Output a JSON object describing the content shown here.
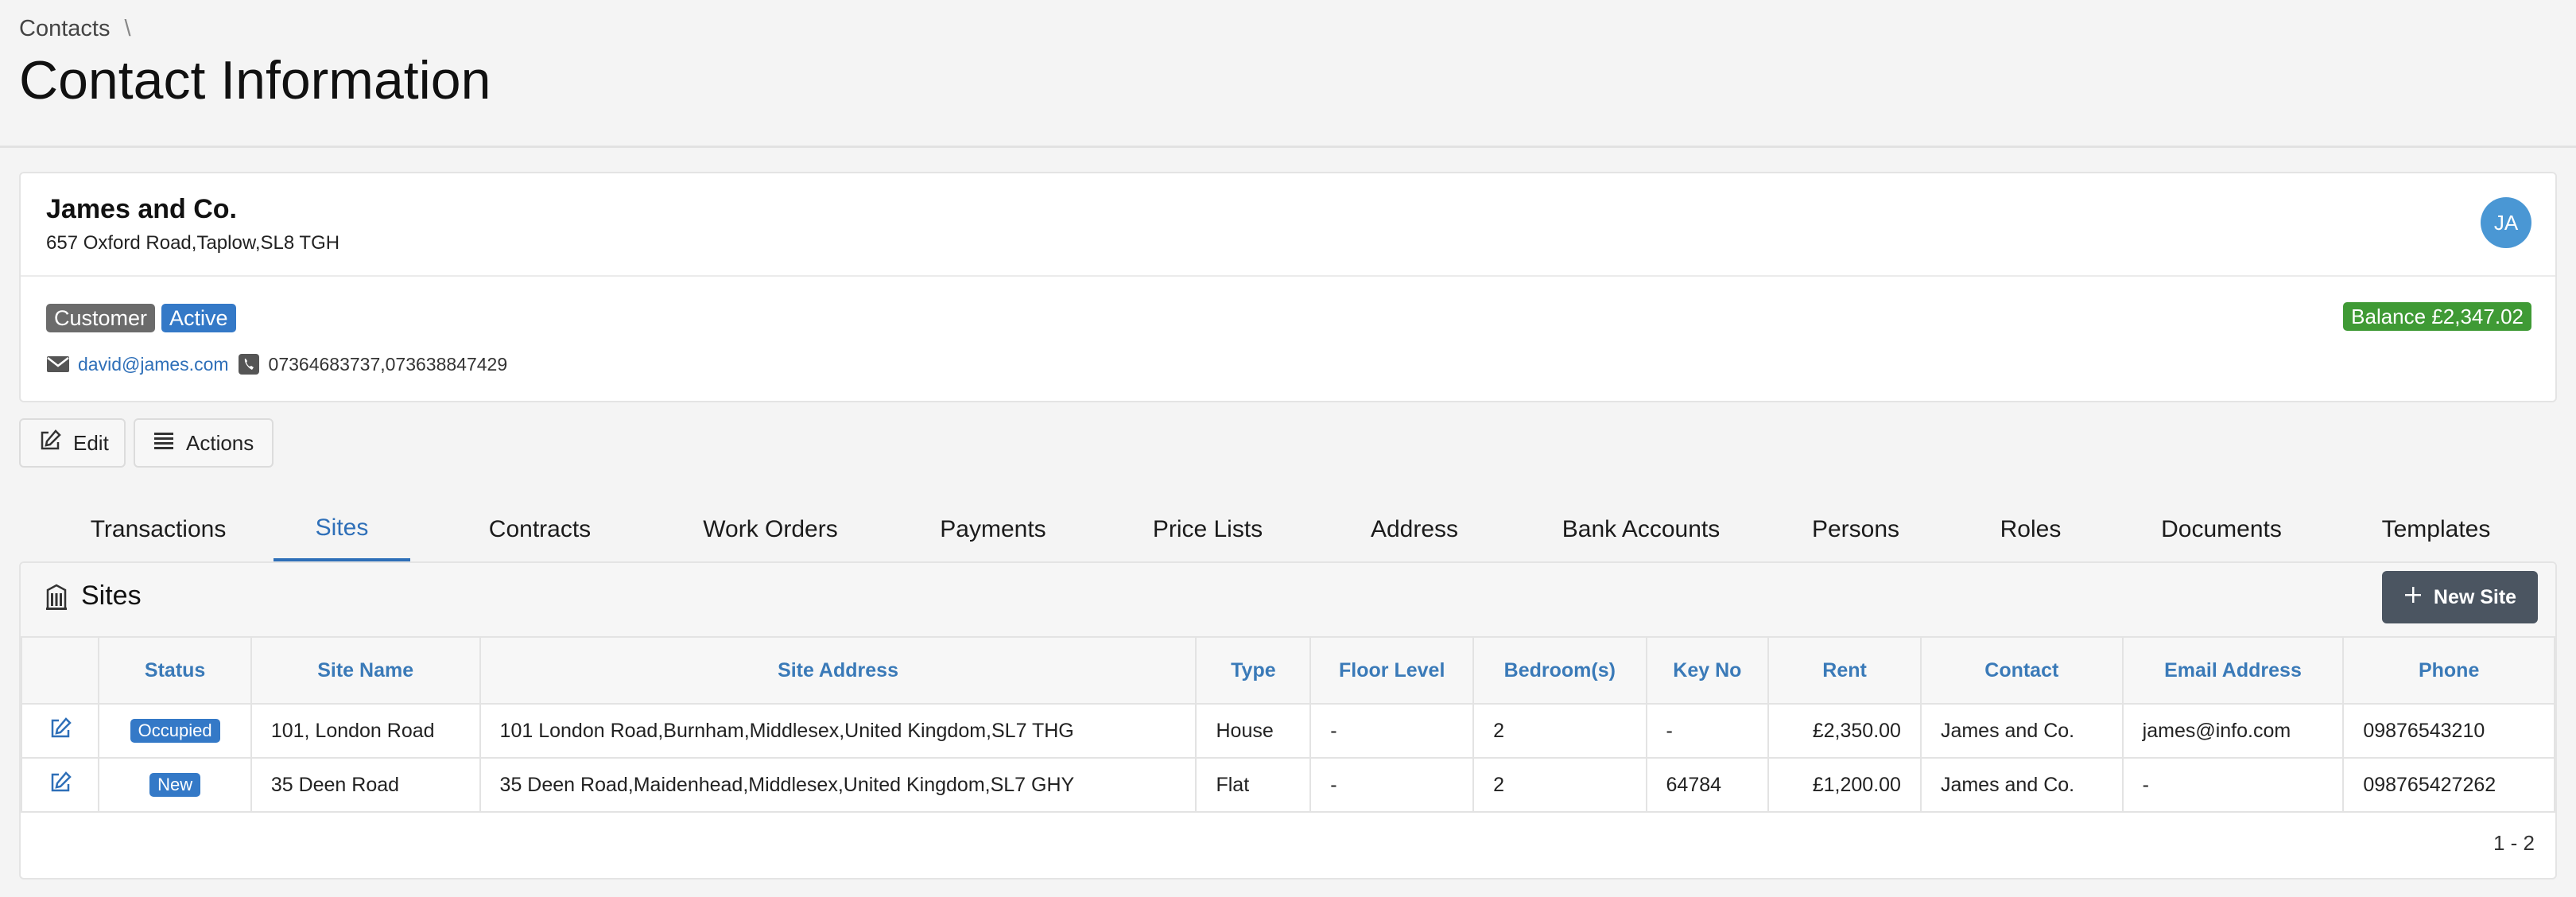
{
  "breadcrumb": {
    "root": "Contacts",
    "separator": "\\"
  },
  "page": {
    "title": "Contact Information"
  },
  "contact": {
    "name": "James and Co.",
    "address": "657 Oxford Road,Taplow,SL8 TGH",
    "avatar_initials": "JA",
    "badges": [
      "Customer",
      "Active"
    ],
    "balance": "Balance £2,347.02",
    "email": "david@james.com",
    "phones": "07364683737,073638847429"
  },
  "toolbar": {
    "edit_label": "Edit",
    "actions_label": "Actions"
  },
  "tabs": [
    {
      "label": "Transactions"
    },
    {
      "label": "Sites",
      "active": true
    },
    {
      "label": "Contracts"
    },
    {
      "label": "Work Orders"
    },
    {
      "label": "Payments"
    },
    {
      "label": "Price Lists"
    },
    {
      "label": "Address"
    },
    {
      "label": "Bank Accounts"
    },
    {
      "label": "Persons"
    },
    {
      "label": "Roles"
    },
    {
      "label": "Documents"
    },
    {
      "label": "Templates"
    }
  ],
  "sites": {
    "title": "Sites",
    "new_button": "New Site",
    "columns": [
      "Status",
      "Site Name",
      "Site Address",
      "Type",
      "Floor Level",
      "Bedroom(s)",
      "Key No",
      "Rent",
      "Contact",
      "Email Address",
      "Phone"
    ],
    "rows": [
      {
        "status": "Occupied",
        "site_name": "101, London Road",
        "site_address": "101 London Road,Burnham,Middlesex,United Kingdom,SL7 THG",
        "type": "House",
        "floor_level": "-",
        "bedrooms": "2",
        "key_no": "-",
        "rent": "£2,350.00",
        "contact": "James and Co.",
        "email": "james@info.com",
        "phone": "09876543210"
      },
      {
        "status": "New",
        "site_name": "35 Deen Road",
        "site_address": "35 Deen Road,Maidenhead,Middlesex,United Kingdom,SL7 GHY",
        "type": "Flat",
        "floor_level": "-",
        "bedrooms": "2",
        "key_no": "64784",
        "rent": "£1,200.00",
        "contact": "James and Co.",
        "email": "-",
        "phone": "098765427262"
      }
    ],
    "pagination": "1 - 2"
  },
  "colors": {
    "accent": "#2e6fb8",
    "balance": "#3f9a35",
    "badge_grey": "#6b6b6b",
    "badge_blue": "#3479c7",
    "new_button": "#4b5561",
    "avatar": "#4a97d4"
  }
}
